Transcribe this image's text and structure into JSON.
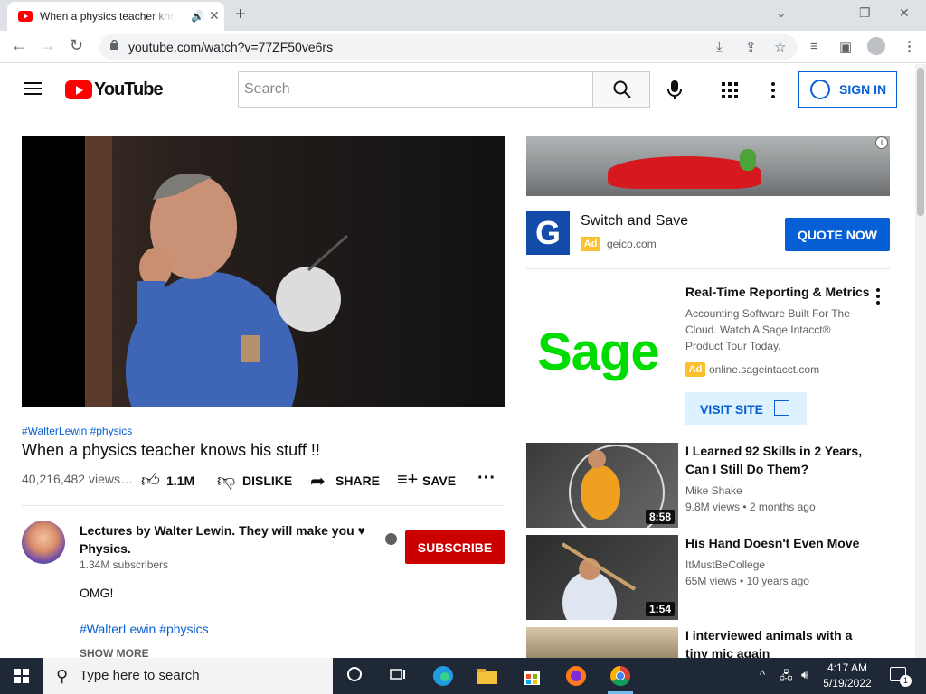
{
  "browser": {
    "tab_title": "When a physics teacher knows his stuff !! - YouTube",
    "url": "youtube.com/watch?v=77ZF50ve6rs"
  },
  "youtube": {
    "logo_text": "YouTube",
    "search_placeholder": "Search",
    "sign_in_label": "SIGN IN"
  },
  "video": {
    "hashtags": "#WalterLewin #physics",
    "title": "When a physics teacher knows his stuff !!",
    "views": "40,216,482 views…",
    "likes": "1.1M",
    "dislike_label": "DISLIKE",
    "share_label": "SHARE",
    "save_label": "SAVE"
  },
  "channel": {
    "name": "Lectures by Walter Lewin. They will make you ♥ Physics.",
    "subscribers": "1.34M subscribers",
    "subscribe_label": "SUBSCRIBE",
    "description_line1": "OMG!",
    "description_tags": "#WalterLewin #physics",
    "show_more_label": "SHOW MORE"
  },
  "ads": {
    "banner": {
      "title": "Switch and Save",
      "badge": "Ad",
      "domain": "geico.com",
      "cta": "QUOTE NOW",
      "logo_letter": "G"
    },
    "sage": {
      "title": "Real-Time Reporting & Metrics",
      "description": "Accounting Software Built For The Cloud. Watch A Sage Intacct® Product Tour Today.",
      "badge": "Ad",
      "domain": "online.sageintacct.com",
      "cta": "VISIT SITE",
      "logo_text": "Sage"
    }
  },
  "recommendations": [
    {
      "title": "I Learned 92 Skills in 2 Years, Can I Still Do Them?",
      "channel": "Mike Shake",
      "views": "9.8M views",
      "age": "2 months ago",
      "duration": "8:58"
    },
    {
      "title": "His Hand Doesn't Even Move",
      "channel": "ItMustBeCollege",
      "views": "65M views",
      "age": "10 years ago",
      "duration": "1:54"
    },
    {
      "title": "I interviewed animals with a tiny mic again",
      "channel": "",
      "views": "",
      "age": "",
      "duration": ""
    }
  ],
  "taskbar": {
    "search_placeholder": "Type here to search",
    "time": "4:17 AM",
    "date": "5/19/2022",
    "notification_count": "1"
  },
  "colors": {
    "youtube_red": "#ff0000",
    "link_blue": "#065fd4",
    "subscribe_red": "#cc0000",
    "taskbar_bg": "#1f2836"
  }
}
